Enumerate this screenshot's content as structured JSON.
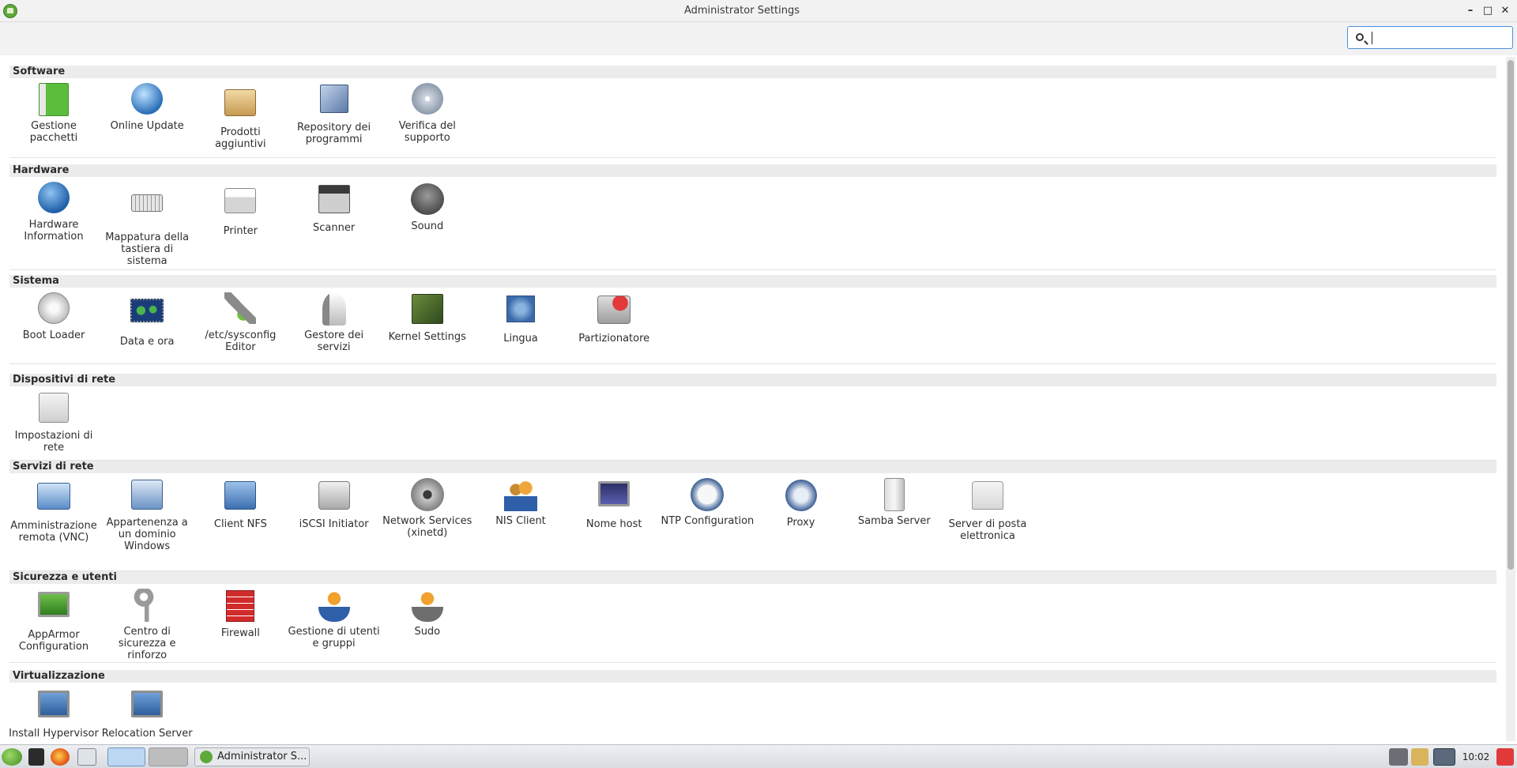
{
  "window": {
    "title": "Administrator Settings",
    "minimize": "–",
    "maximize": "□",
    "close": "✕"
  },
  "search": {
    "placeholder": "",
    "value": ""
  },
  "categories": [
    {
      "title": "Software",
      "items": [
        {
          "label": "Gestione pacchetti",
          "icon": "package-manager-icon"
        },
        {
          "label": "Online Update",
          "icon": "online-update-icon"
        },
        {
          "label": "Prodotti aggiuntivi",
          "icon": "add-on-products-icon"
        },
        {
          "label": "Repository dei programmi",
          "icon": "software-repositories-icon"
        },
        {
          "label": "Verifica del supporto",
          "icon": "media-check-icon"
        }
      ]
    },
    {
      "title": "Hardware",
      "items": [
        {
          "label": "Hardware Information",
          "icon": "info-icon"
        },
        {
          "label": "Mappatura della tastiera di sistema",
          "icon": "keyboard-icon"
        },
        {
          "label": "Printer",
          "icon": "printer-icon"
        },
        {
          "label": "Scanner",
          "icon": "scanner-icon"
        },
        {
          "label": "Sound",
          "icon": "sound-icon"
        }
      ]
    },
    {
      "title": "Sistema",
      "items": [
        {
          "label": "Boot Loader",
          "icon": "power-icon"
        },
        {
          "label": "Data e ora",
          "icon": "world-map-icon"
        },
        {
          "label": "/etc/sysconfig Editor",
          "icon": "tools-icon"
        },
        {
          "label": "Gestore dei servizi",
          "icon": "rocket-icon"
        },
        {
          "label": "Kernel Settings",
          "icon": "kernel-wrench-icon"
        },
        {
          "label": "Lingua",
          "icon": "language-flag-icon"
        },
        {
          "label": "Partizionatore",
          "icon": "disk-partition-icon"
        }
      ]
    },
    {
      "title": "Dispositivi di rete",
      "items": [
        {
          "label": "Impostazioni di rete",
          "icon": "network-card-icon"
        }
      ]
    },
    {
      "title": "Servizi di rete",
      "items": [
        {
          "label": "Amministrazione remota (VNC)",
          "icon": "remote-admin-icon"
        },
        {
          "label": "Appartenenza a un dominio Windows",
          "icon": "windows-domain-icon"
        },
        {
          "label": "Client NFS",
          "icon": "nfs-folder-icon"
        },
        {
          "label": "iSCSI Initiator",
          "icon": "iscsi-drive-icon"
        },
        {
          "label": "Network Services (xinetd)",
          "icon": "network-services-icon"
        },
        {
          "label": "NIS Client",
          "icon": "nis-client-icon"
        },
        {
          "label": "Nome host",
          "icon": "monitor-icon"
        },
        {
          "label": "NTP Configuration",
          "icon": "clock-icon"
        },
        {
          "label": "Proxy",
          "icon": "proxy-icon"
        },
        {
          "label": "Samba Server",
          "icon": "samba-server-icon"
        },
        {
          "label": "Server di posta elettronica",
          "icon": "mail-icon"
        }
      ]
    },
    {
      "title": "Sicurezza e utenti",
      "items": [
        {
          "label": "AppArmor Configuration",
          "icon": "apparmor-icon"
        },
        {
          "label": "Centro di sicurezza e rinforzo",
          "icon": "keys-icon"
        },
        {
          "label": "Firewall",
          "icon": "firewall-icon"
        },
        {
          "label": "Gestione di utenti e gruppi",
          "icon": "user-icon"
        },
        {
          "label": "Sudo",
          "icon": "sudo-icon"
        }
      ]
    },
    {
      "title": "Virtualizzazione",
      "items": [
        {
          "label": "Install Hypervisor",
          "icon": "hypervisor-icon"
        },
        {
          "label": "Relocation Server",
          "icon": "relocation-server-icon"
        }
      ]
    }
  ],
  "taskbar": {
    "task_label": "Administrator S...",
    "clock": "10:02"
  }
}
